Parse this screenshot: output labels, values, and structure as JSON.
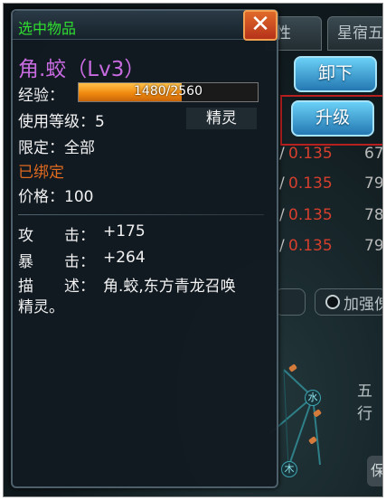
{
  "background": {
    "tabs": [
      "性",
      "星宿五"
    ],
    "unequip_button": "卸下",
    "upgrade_button": "升级",
    "rows": [
      {
        "slash": "/",
        "value": "0.135",
        "num": "67"
      },
      {
        "slash": "/",
        "value": "0.135",
        "num": "79"
      },
      {
        "slash": "/",
        "value": "0.135",
        "num": "78"
      },
      {
        "slash": "/",
        "value": "0.135",
        "num": "79"
      }
    ],
    "enhance_option": "加强傀",
    "element_label": "五行",
    "nodes": [
      "水",
      "木"
    ],
    "small_button": "保"
  },
  "panel": {
    "title": "选中物品",
    "close_glyph": "✕",
    "item_name": "角.蛟（Lv3）",
    "exp_label": "经验：",
    "exp_current": 1480,
    "exp_max": 2560,
    "exp_text": "1480/2560",
    "level_req": "使用等级：5",
    "category_tag": "精灵",
    "restriction": "限定：全部",
    "bound_status": "已绑定",
    "price": "价格：100",
    "attributes": [
      {
        "key": "攻　　击：",
        "value": "+175"
      },
      {
        "key": "暴　　击：",
        "value": "+264"
      }
    ],
    "description_key": "描　　述：",
    "description_line1": "角.蛟,东方青龙召唤",
    "description_line2": "精灵。"
  },
  "colors": {
    "title_green": "#2fe02f",
    "item_purple": "#c86ae0",
    "bound_orange": "#e06a20",
    "value_red": "#d63f2d"
  }
}
